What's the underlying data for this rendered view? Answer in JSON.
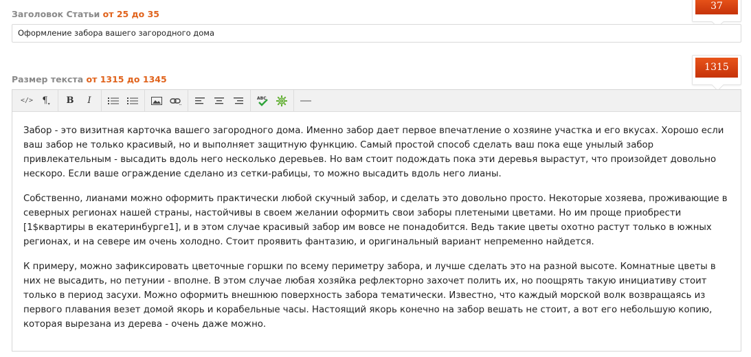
{
  "title_field": {
    "label": "Заголовок Статьи",
    "range": "от 25 до 35",
    "value": "Оформление забора вашего загородного дома",
    "counter": "37"
  },
  "text_field": {
    "label": "Размер текста",
    "range": "от 1315 до 1345",
    "counter": "1315"
  },
  "toolbar": {
    "html_label": "</>",
    "pilcrow": "¶",
    "bold": "B",
    "italic": "I"
  },
  "content": {
    "paragraphs": [
      "Забор - это визитная карточка вашего загородного дома. Именно забор дает первое впечатление о хозяине участка и его вкусах. Хорошо если ваш забор не только красивый, но и выполняет защитную функцию. Самый простой способ сделать ваш пока еще унылый забор привлекательным - высадить вдоль него несколько деревьев. Но вам стоит подождать пока эти деревья вырастут, что произойдет довольно нескоро. Если ваше ограждение сделано из сетки-рабицы, то можно высадить вдоль него лианы.",
      "Собственно, лианами можно оформить практически любой скучный забор, и сделать это довольно просто. Некоторые хозяева, проживающие в северных регионах нашей страны, настойчивы в своем желании оформить свои заборы плетеными цветами. Но им проще приобрести [1$квартиры в екатеринбурге1], и в этом случае красивый забор им вовсе не понадобится. Ведь такие цветы охотно растут только в южных регионах, и на севере им очень холодно. Стоит проявить фантазию, и оригинальный вариант непременно найдется.",
      "К примеру, можно зафиксировать цветочные горшки по всему периметру забора, и лучше сделать это на разной высоте. Комнатные цветы в них не высадить, но петунии - вполне. В этом случае любая хозяйка рефлекторно захочет полить их, но поощрять такую инициативу стоит только в период засухи. Можно оформить внешнюю поверхность забора тематически. Известно, что каждый морской волк возвращаясь из первого плавания везет домой якорь и корабельные часы. Настоящий якорь конечно на забор вешать не стоит, а вот его небольшую копию, которая вырезана из дерева - очень даже можно."
    ]
  },
  "colors": {
    "accent": "#e0621b",
    "counter_bg": "#d8400f",
    "label": "#8a8a8a"
  }
}
